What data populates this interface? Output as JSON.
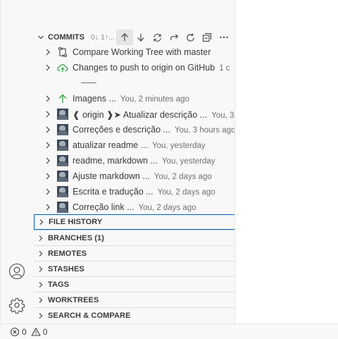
{
  "commits_section": {
    "title": "COMMITS",
    "subtitle": "0↓ 1↑..."
  },
  "commit_rows": [
    {
      "label": "Compare Working Tree with master",
      "desc": ""
    },
    {
      "label": "Changes to push to origin on GitHub",
      "desc": "1 c"
    },
    {
      "label": "Imagens ...",
      "desc": "You, 2 minutes ago"
    },
    {
      "label": "❰ origin ❱➤  Atualizar descrição ...",
      "desc": "You, 3"
    },
    {
      "label": "Correções e descrição ...",
      "desc": "You, 3 hours ago"
    },
    {
      "label": "atualizar readme ...",
      "desc": "You, yesterday"
    },
    {
      "label": "readme, markdown ...",
      "desc": "You, yesterday"
    },
    {
      "label": "Ajuste markdown ...",
      "desc": "You, 2 days ago"
    },
    {
      "label": "Escrita e tradução ...",
      "desc": "You, 2 days ago"
    },
    {
      "label": "Correção link ...",
      "desc": "You, 2 days ago"
    }
  ],
  "sections": [
    {
      "label": "FILE HISTORY"
    },
    {
      "label": "BRANCHES (1)"
    },
    {
      "label": "REMOTES"
    },
    {
      "label": "STASHES"
    },
    {
      "label": "TAGS"
    },
    {
      "label": "WORKTREES"
    },
    {
      "label": "SEARCH & COMPARE"
    }
  ],
  "status_bar": {
    "errors": "0",
    "warnings": "0"
  },
  "icons": {
    "toolbar": [
      "arrow-up-icon",
      "arrow-down-icon",
      "sync-icon",
      "redo-icon",
      "refresh-icon",
      "collapse-all-icon",
      "more-icon"
    ],
    "activity": [
      "account-icon",
      "settings-gear-icon"
    ]
  },
  "colors": {
    "focus_border": "#005fb8",
    "push_arrow": "#2ea043",
    "cloud_upload": "#2ea043"
  }
}
